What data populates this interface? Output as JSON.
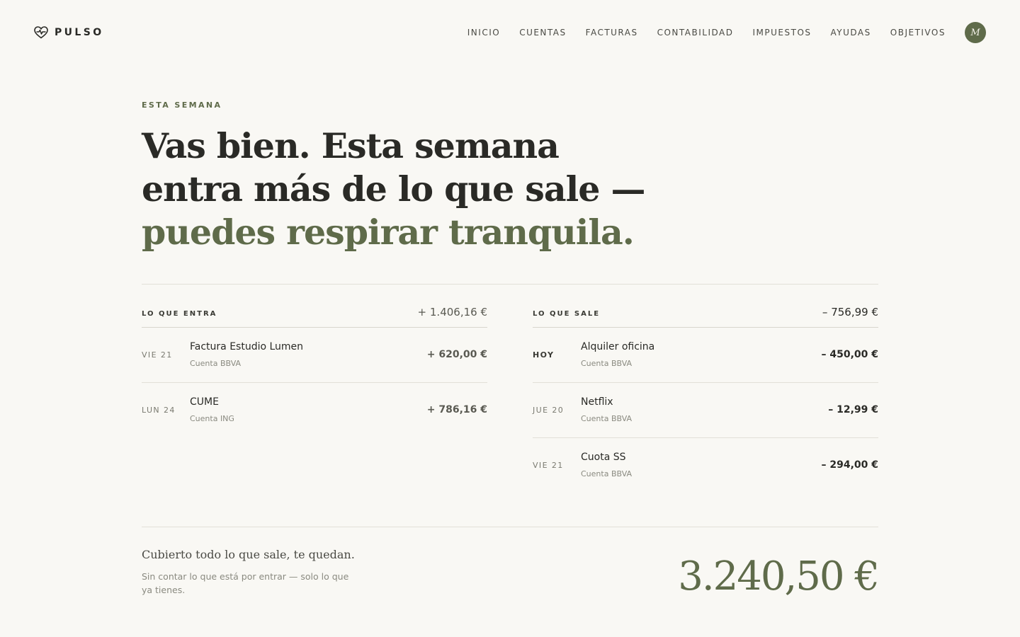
{
  "brand": {
    "name": "PULSO",
    "icon": "heart-pulse-icon"
  },
  "nav": {
    "items": [
      "INICIO",
      "CUENTAS",
      "FACTURAS",
      "CONTABILIDAD",
      "IMPUESTOS",
      "AYUDAS",
      "OBJETIVOS"
    ],
    "avatar_initial": "M"
  },
  "hero": {
    "eyebrow": "ESTA SEMANA",
    "headline_plain": "Vas bien. Esta semana entra más de lo que sale —",
    "headline_accent": "puedes respirar tranquila."
  },
  "income": {
    "label": "LO QUE ENTRA",
    "total": "+ 1.406,16 €",
    "rows": [
      {
        "date": "VIE 21",
        "title": "Factura Estudio Lumen",
        "account": "Cuenta BBVA",
        "amount": "+ 620,00 €"
      },
      {
        "date": "LUN 24",
        "title": "CUME",
        "account": "Cuenta ING",
        "amount": "+ 786,16 €"
      }
    ]
  },
  "expenses": {
    "label": "LO QUE SALE",
    "total": "– 756,99 €",
    "rows": [
      {
        "date": "HOY",
        "title": "Alquiler oficina",
        "account": "Cuenta BBVA",
        "amount": "– 450,00 €"
      },
      {
        "date": "JUE 20",
        "title": "Netflix",
        "account": "Cuenta BBVA",
        "amount": "– 12,99 €"
      },
      {
        "date": "VIE 21",
        "title": "Cuota SS",
        "account": "Cuenta BBVA",
        "amount": "– 294,00 €"
      }
    ]
  },
  "summary": {
    "title": "Cubierto todo lo que sale, te quedan.",
    "subtitle": "Sin contar lo que está por entrar — solo lo que ya tienes.",
    "amount": "3.240,50 €"
  },
  "colors": {
    "accent": "#5f6b4a",
    "background": "#f9f8f4",
    "text": "#2a2a26"
  }
}
